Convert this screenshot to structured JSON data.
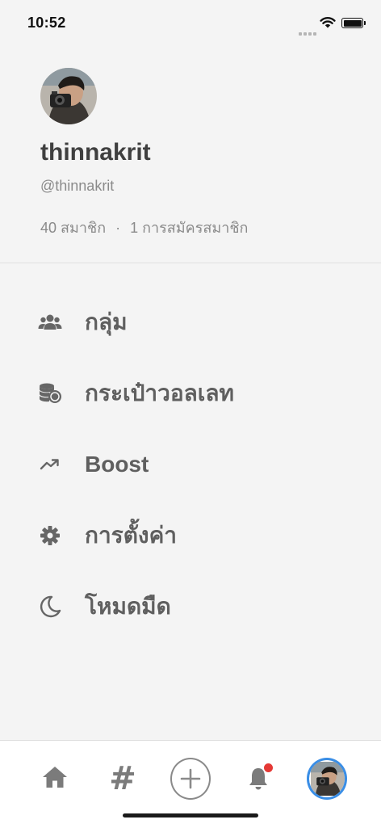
{
  "status_bar": {
    "time": "10:52"
  },
  "profile": {
    "display_name": "thinnakrit",
    "handle": "@thinnakrit",
    "members": "40 สมาชิก",
    "separator": "·",
    "subscriptions": "1 การสมัครสมาชิก"
  },
  "menu": {
    "items": [
      {
        "label": "กลุ่ม",
        "icon": "users-icon"
      },
      {
        "label": "กระเป๋าวอลเลท",
        "icon": "coins-icon"
      },
      {
        "label": "Boost",
        "icon": "trending-up-icon"
      },
      {
        "label": "การตั้งค่า",
        "icon": "gear-icon"
      },
      {
        "label": "โหมดมืด",
        "icon": "moon-icon"
      }
    ]
  },
  "tab_bar": {
    "hash_glyph": "#",
    "items": [
      "home-icon",
      "hashtag-icon",
      "add-icon",
      "bell-icon",
      "avatar"
    ]
  },
  "colors": {
    "accent": "#3a8ee6",
    "notification": "#e53935"
  }
}
